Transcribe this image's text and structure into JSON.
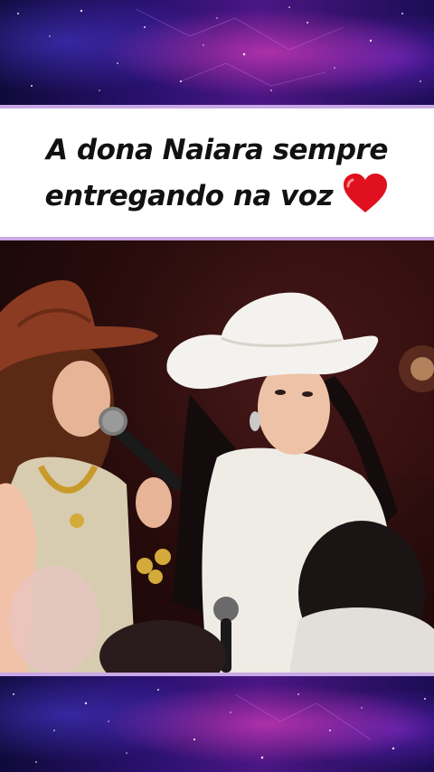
{
  "caption": {
    "line1": "A dona Naiara sempre",
    "line2": "entregando na voz",
    "emoji": "❤️"
  },
  "colors": {
    "divider": "#c9a8e6",
    "caption_bg": "#ffffff",
    "caption_text": "#111111",
    "heart": "#e0101e"
  },
  "photo": {
    "subject": "two-singers-in-cowboy-hats-with-microphones"
  }
}
